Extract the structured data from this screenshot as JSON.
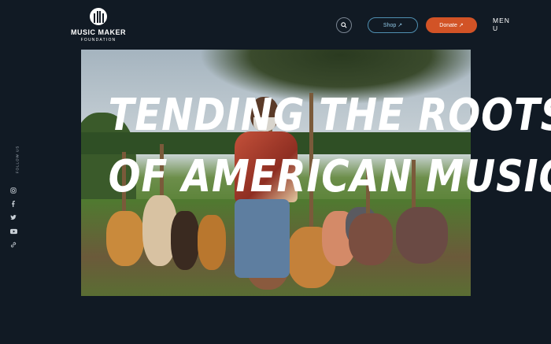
{
  "logo": {
    "name": "MUSIC MAKER",
    "sub": "FOUNDATION"
  },
  "header": {
    "shop_label": "Shop ↗",
    "donate_label": "Donate ↗",
    "menu_label": "MENU"
  },
  "social": {
    "follow_label": "FOLLOW US",
    "icons": [
      "instagram-icon",
      "facebook-icon",
      "twitter-icon",
      "youtube-icon",
      "link-icon"
    ]
  },
  "hero": {
    "line1": "TENDING THE ROOTS",
    "line2": "OF AMERICAN MUSIC"
  },
  "colors": {
    "background": "#111a24",
    "donate": "#d25326",
    "shop_border": "#4f8fb1"
  }
}
